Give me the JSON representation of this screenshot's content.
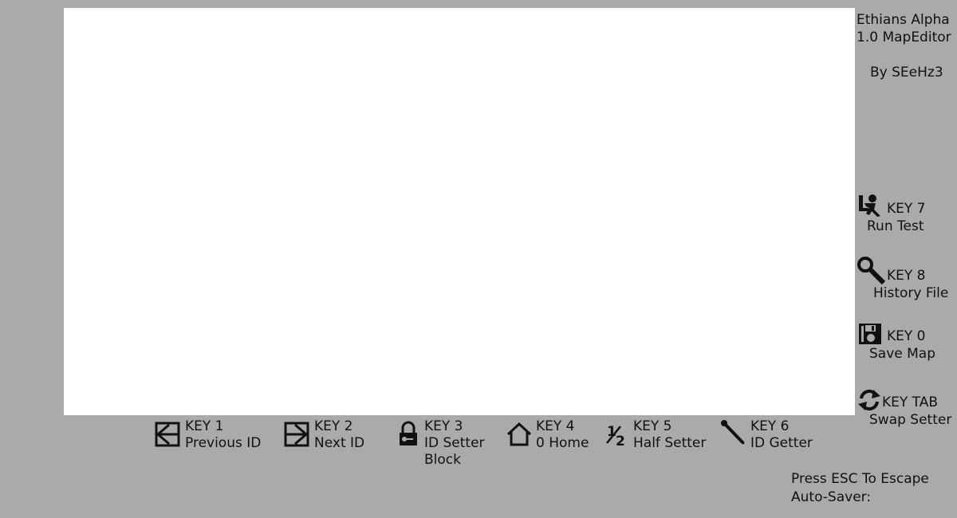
{
  "app": {
    "title": "Ethians Alpha\n1.0 MapEditor",
    "author": "By SEeHz3"
  },
  "sidebar": {
    "items": [
      {
        "key": "KEY 7",
        "label": "Run Test",
        "icon": "runner-icon"
      },
      {
        "key": "KEY 8",
        "label": "History File",
        "icon": "magnifier-icon"
      },
      {
        "key": "KEY 0",
        "label": "Save Map",
        "icon": "floppy-disk-icon"
      },
      {
        "key": "KEY TAB",
        "label": "Swap Setter",
        "icon": "swap-arrows-icon"
      }
    ]
  },
  "toolbar": {
    "items": [
      {
        "key": "KEY 1",
        "label": "Previous ID",
        "label2": "",
        "icon": "previous-arrow-icon"
      },
      {
        "key": "KEY 2",
        "label": "Next ID",
        "label2": "",
        "icon": "next-arrow-icon"
      },
      {
        "key": "KEY 3",
        "label": "ID Setter",
        "label2": "Block",
        "icon": "lock-icon"
      },
      {
        "key": "KEY 4",
        "label": "0 Home",
        "label2": "",
        "icon": "home-icon"
      },
      {
        "key": "KEY 5",
        "label": "Half Setter",
        "label2": "",
        "icon": "one-half-icon"
      },
      {
        "key": "KEY 6",
        "label": "ID Getter",
        "label2": "",
        "icon": "eyedropper-icon"
      }
    ]
  },
  "footer": {
    "escape_hint": "Press ESC To Escape",
    "autosaver": "Auto-Saver:"
  }
}
